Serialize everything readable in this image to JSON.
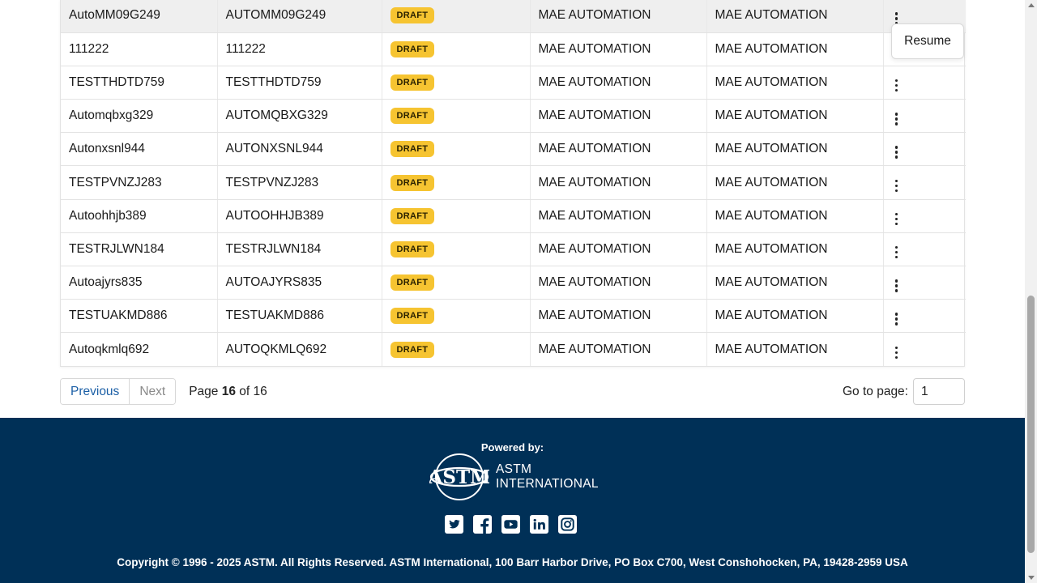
{
  "table": {
    "rows": [
      {
        "name": "AutoMM09G249",
        "code": "AUTOMM09G249",
        "status": "DRAFT",
        "org": "MAE AUTOMATION",
        "owner": "MAE AUTOMATION"
      },
      {
        "name": "111222",
        "code": "111222",
        "status": "DRAFT",
        "org": "MAE AUTOMATION",
        "owner": "MAE AUTOMATION"
      },
      {
        "name": "TESTTHDTD759",
        "code": "TESTTHDTD759",
        "status": "DRAFT",
        "org": "MAE AUTOMATION",
        "owner": "MAE AUTOMATION"
      },
      {
        "name": "Automqbxg329",
        "code": "AUTOMQBXG329",
        "status": "DRAFT",
        "org": "MAE AUTOMATION",
        "owner": "MAE AUTOMATION"
      },
      {
        "name": "Autonxsnl944",
        "code": "AUTONXSNL944",
        "status": "DRAFT",
        "org": "MAE AUTOMATION",
        "owner": "MAE AUTOMATION"
      },
      {
        "name": "TESTPVNZJ283",
        "code": "TESTPVNZJ283",
        "status": "DRAFT",
        "org": "MAE AUTOMATION",
        "owner": "MAE AUTOMATION"
      },
      {
        "name": "Autoohhjb389",
        "code": "AUTOOHHJB389",
        "status": "DRAFT",
        "org": "MAE AUTOMATION",
        "owner": "MAE AUTOMATION"
      },
      {
        "name": "TESTRJLWN184",
        "code": "TESTRJLWN184",
        "status": "DRAFT",
        "org": "MAE AUTOMATION",
        "owner": "MAE AUTOMATION"
      },
      {
        "name": "Autoajyrs835",
        "code": "AUTOAJYRS835",
        "status": "DRAFT",
        "org": "MAE AUTOMATION",
        "owner": "MAE AUTOMATION"
      },
      {
        "name": "TESTUAKMD886",
        "code": "TESTUAKMD886",
        "status": "DRAFT",
        "org": "MAE AUTOMATION",
        "owner": "MAE AUTOMATION"
      },
      {
        "name": "Autoqkmlq692",
        "code": "AUTOQKMLQ692",
        "status": "DRAFT",
        "org": "MAE AUTOMATION",
        "owner": "MAE AUTOMATION"
      }
    ]
  },
  "popover": {
    "resume_label": "Resume"
  },
  "pagination": {
    "previous_label": "Previous",
    "next_label": "Next",
    "page_prefix": "Page",
    "current_page": "16",
    "of_label": "of",
    "total_pages": "16",
    "goto_label": "Go to page:",
    "goto_value": "1"
  },
  "footer": {
    "powered_by": "Powered by:",
    "logo_line1": "ASTM",
    "logo_line2": "INTERNATIONAL",
    "logo_mark": "ASTM",
    "socials": [
      "twitter-icon",
      "facebook-icon",
      "youtube-icon",
      "linkedin-icon",
      "instagram-icon"
    ],
    "copyright": "Copyright © 1996 - 2025 ASTM. All Rights Reserved. ASTM International, 100 Barr Harbor Drive, PO Box C700, West Conshohocken, PA, 19428-2959 USA"
  },
  "colors": {
    "footer_bg": "#003057",
    "badge_bg": "#f6c431",
    "link": "#1b5fa6"
  }
}
